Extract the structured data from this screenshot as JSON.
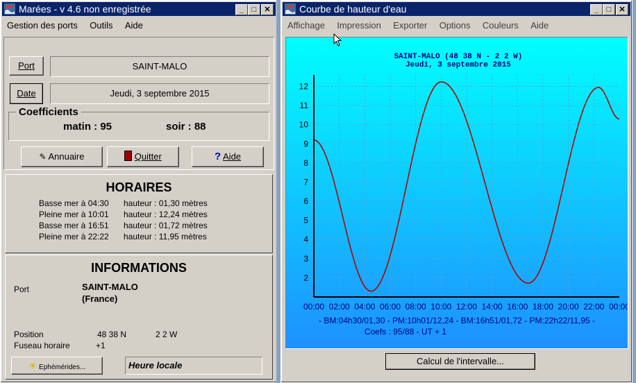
{
  "main_window": {
    "title": "Marées - v 4.6 non enregistrée",
    "menu": [
      "Gestion des ports",
      "Outils",
      "Aide"
    ],
    "port_button": "Port",
    "port_value": "SAINT-MALO",
    "date_button": "Date",
    "date_value": "Jeudi, 3 septembre 2015",
    "coefficients": {
      "label": "Coefficients",
      "matin": "matin : 95",
      "soir": "soir : 88"
    },
    "buttons": {
      "annuaire": "Annuaire",
      "quitter": "Quitter",
      "aide": "Aide"
    },
    "horaires": {
      "title": "HORAIRES",
      "rows": [
        {
          "event": "Basse mer à 04:30",
          "height": "hauteur : 01,30 mètres"
        },
        {
          "event": "Pleine mer à 10:01",
          "height": "hauteur : 12,24 mètres"
        },
        {
          "event": "Basse mer à 16:51",
          "height": "hauteur : 01,72 mètres"
        },
        {
          "event": "Pleine mer à 22:22",
          "height": "hauteur : 11,95 mètres"
        }
      ]
    },
    "informations": {
      "title": "INFORMATIONS",
      "port_label": "Port",
      "port_name": "SAINT-MALO",
      "country": "(France)",
      "position_label": "Position",
      "lat": "48 38 N",
      "lon": "2  2 W",
      "timezone_label": "Fuseau horaire",
      "timezone_value": "+1",
      "ephemerides_button": "Ephémérides...",
      "local_time": "Heure locale"
    }
  },
  "chart_window": {
    "title": "Courbe de hauteur d'eau",
    "menu": [
      "Affichage",
      "Impression",
      "Exporter",
      "Options",
      "Couleurs",
      "Aide"
    ],
    "interval_button": "Calcul de l'intervalle...",
    "colors": {
      "curve": "#b00000",
      "bg_top": "#00ffff",
      "bg_bottom": "#1e90ff",
      "text": "#000080"
    }
  },
  "chart_data": {
    "type": "line",
    "title": "SAINT-MALO (48 38 N -   2  2 W)",
    "subtitle": "Jeudi, 3 septembre 2015",
    "x_ticks": [
      "00:00",
      "02:00",
      "04:00",
      "06:00",
      "08:00",
      "10:00",
      "12:00",
      "14:00",
      "16:00",
      "18:00",
      "20:00",
      "22:00",
      "00:00"
    ],
    "y_ticks": [
      "2",
      "3",
      "4",
      "5",
      "6",
      "7",
      "8",
      "9",
      "10",
      "11",
      "12"
    ],
    "ylim": [
      1,
      12.6
    ],
    "xlim_hours": [
      0,
      24
    ],
    "grid": true,
    "series": [
      {
        "x": [
          0,
          4.5,
          10.017,
          16.85,
          22.367,
          24
        ],
        "y": [
          9.2,
          1.3,
          12.24,
          1.72,
          11.95,
          10.3
        ]
      }
    ],
    "footer_line1": "- BM:04h30/01,30 - PM:10h01/12,24 - BM:16h51/01,72 - PM:22h22/11,95 -",
    "footer_line2": "Coefs : 95/88 - UT + 1"
  }
}
